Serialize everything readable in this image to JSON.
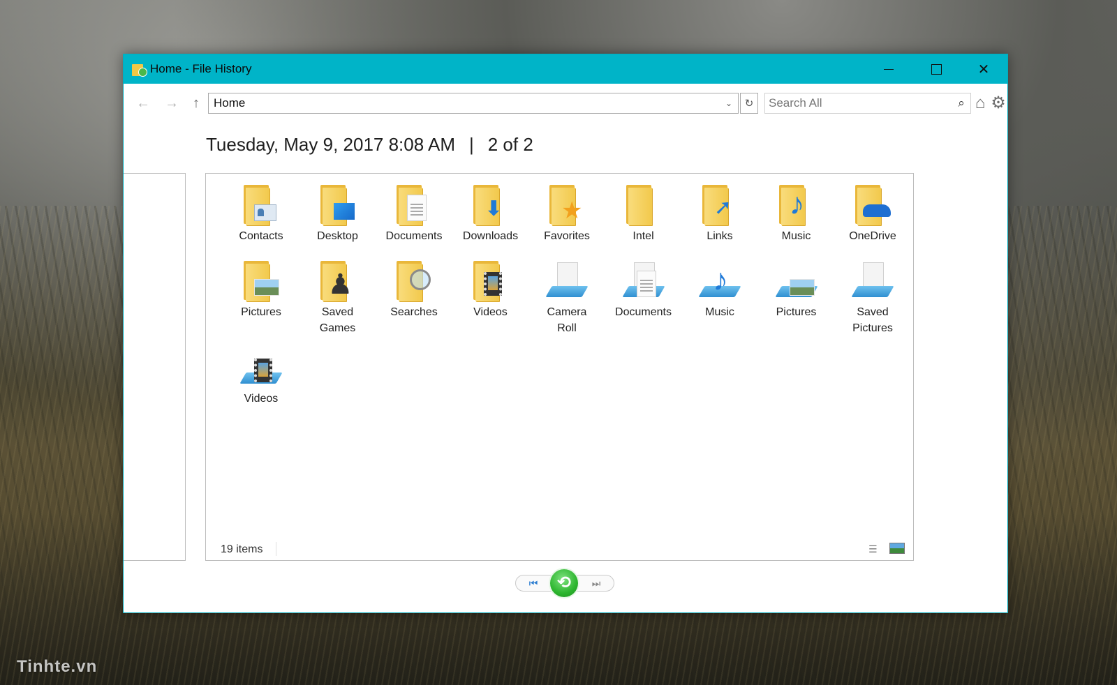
{
  "window": {
    "title": "Home - File History",
    "controls": {
      "minimize": "–",
      "maximize": "☐",
      "close": "✕"
    }
  },
  "toolbar": {
    "back": "←",
    "forward": "→",
    "up": "↑",
    "address": "Home",
    "address_dropdown": "⌄",
    "refresh": "↻",
    "search_placeholder": "Search All",
    "search_icon": "⌕",
    "home_icon": "⌂",
    "settings_icon": "⚙"
  },
  "header": {
    "date": "Tuesday, May 9, 2017 8:08 AM",
    "separator": "|",
    "position": "2 of 2"
  },
  "items": [
    {
      "label": "Contacts",
      "kind": "folder",
      "emblem": "contact-card-icon"
    },
    {
      "label": "Desktop",
      "kind": "folder",
      "emblem": "desktop-screen-icon"
    },
    {
      "label": "Documents",
      "kind": "folder",
      "emblem": "document-icon"
    },
    {
      "label": "Downloads",
      "kind": "folder",
      "emblem": "download-arrow-icon"
    },
    {
      "label": "Favorites",
      "kind": "folder",
      "emblem": "star-icon"
    },
    {
      "label": "Intel",
      "kind": "folder",
      "emblem": ""
    },
    {
      "label": "Links",
      "kind": "folder",
      "emblem": "link-arrow-icon"
    },
    {
      "label": "Music",
      "kind": "folder",
      "emblem": "music-note-icon"
    },
    {
      "label": "OneDrive",
      "kind": "folder",
      "emblem": "cloud-icon"
    },
    {
      "label": "Pictures",
      "kind": "folder",
      "emblem": "landscape-icon"
    },
    {
      "label": "Saved Games",
      "kind": "folder",
      "emblem": "chess-piece-icon"
    },
    {
      "label": "Searches",
      "kind": "folder",
      "emblem": "magnifier-icon"
    },
    {
      "label": "Videos",
      "kind": "folder",
      "emblem": "film-strip-icon"
    },
    {
      "label": "Camera Roll",
      "kind": "library",
      "emblem": "blank-page-icon"
    },
    {
      "label": "Documents",
      "kind": "library",
      "emblem": "document-icon"
    },
    {
      "label": "Music",
      "kind": "library",
      "emblem": "music-note-icon"
    },
    {
      "label": "Pictures",
      "kind": "library",
      "emblem": "landscape-icon"
    },
    {
      "label": "Saved Pictures",
      "kind": "library",
      "emblem": "blank-page-icon"
    },
    {
      "label": "Videos",
      "kind": "library",
      "emblem": "film-strip-icon"
    }
  ],
  "status": {
    "count": "19 items"
  },
  "playback": {
    "previous": "⏮",
    "restore": "⟲",
    "next": "⏭"
  },
  "desktop": {
    "watermark": "Tinhte.vn"
  },
  "colors": {
    "titlebar": "#00b4c8",
    "folder": "#f2c94c",
    "library": "#2f8fd1",
    "restore": "#2cb52e"
  }
}
